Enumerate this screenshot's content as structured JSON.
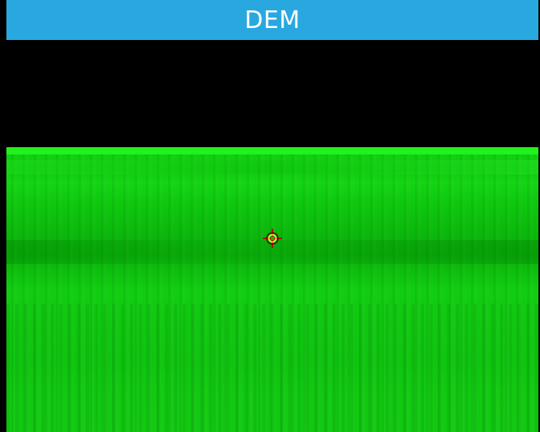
{
  "window": {
    "title": "DEM"
  },
  "colors": {
    "title_bar": "#29a8e0",
    "title_text": "#ffffff",
    "sky": "#000000",
    "horizon": "#22f21b",
    "terrain": "#10c810",
    "reticle_ring": "#ffff00",
    "reticle_cross": "#cc1111"
  },
  "icons": {
    "reticle": "crosshair-icon"
  }
}
